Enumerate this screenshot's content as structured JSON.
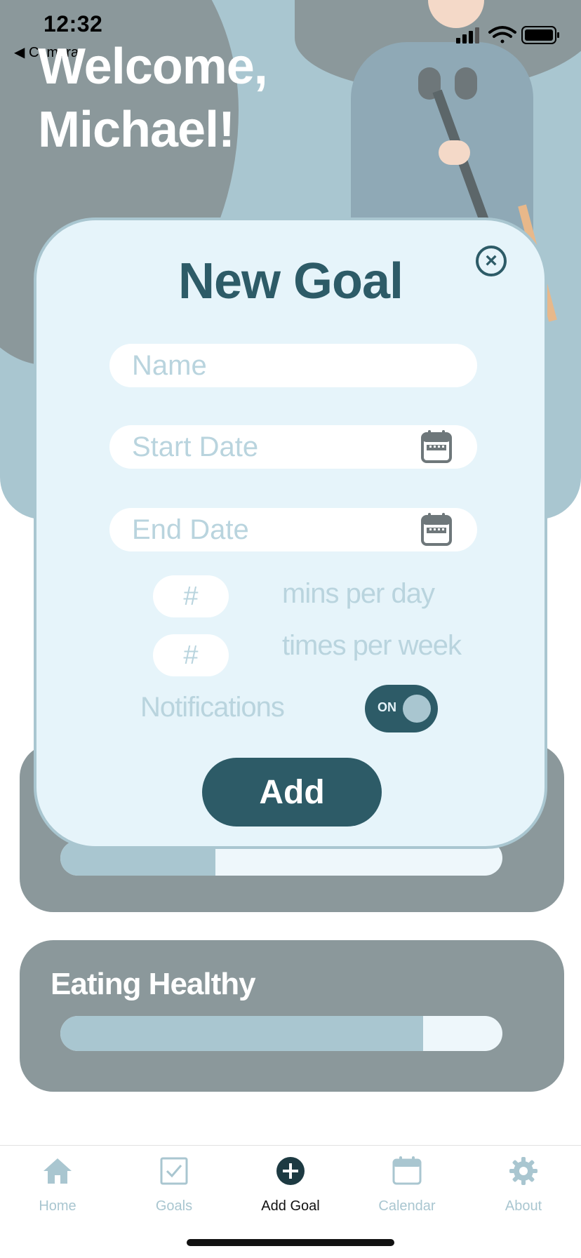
{
  "status_bar": {
    "time": "12:32",
    "back_label": "◀ Camera"
  },
  "welcome": {
    "line1": "Welcome,",
    "line2": "Michael!"
  },
  "goal_cards": [
    {
      "title": "",
      "progress": 0.35
    },
    {
      "title": "Eating Healthy",
      "progress": 0.82
    }
  ],
  "modal": {
    "title": "New Goal",
    "close_icon": "close-circle-icon",
    "name_placeholder": "Name",
    "start_date_placeholder": "Start Date",
    "end_date_placeholder": "End Date",
    "mins_placeholder": "#",
    "mins_label": "mins per day",
    "times_placeholder": "#",
    "times_label": "times per week",
    "notifications_label": "Notifications",
    "toggle_text": "ON",
    "toggle_state": true,
    "add_label": "Add"
  },
  "tabbar": {
    "items": [
      {
        "label": "Home",
        "icon": "home-icon"
      },
      {
        "label": "Goals",
        "icon": "checkbox-icon"
      },
      {
        "label": "Add Goal",
        "icon": "plus-circle-icon"
      },
      {
        "label": "Calendar",
        "icon": "calendar-icon"
      },
      {
        "label": "About",
        "icon": "gear-icon"
      }
    ],
    "active": "Add Goal"
  },
  "colors": {
    "accent": "#2d5b67",
    "light": "#a9c6d0",
    "card": "#8b989b",
    "modal_bg": "#e6f4fa"
  }
}
